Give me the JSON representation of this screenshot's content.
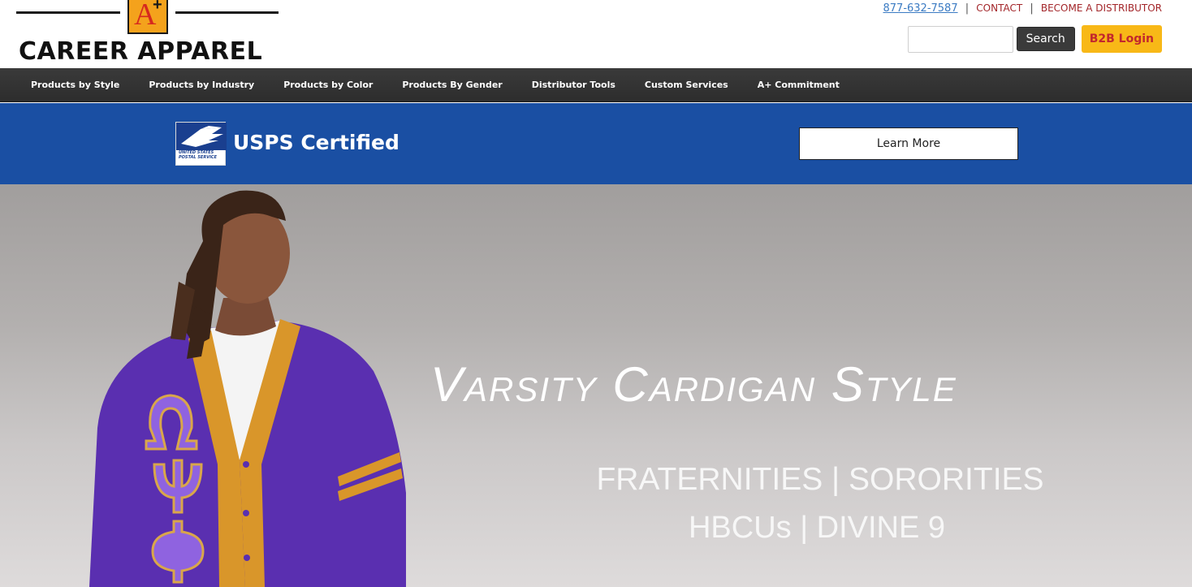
{
  "brand": {
    "logo_letter": "A",
    "logo_plus": "+",
    "name": "CAREER APPAREL"
  },
  "toplinks": {
    "phone": "877-632-7587",
    "separator": "|",
    "contact": "CONTACT",
    "distributor": "BECOME A DISTRIBUTOR"
  },
  "search": {
    "value": "",
    "placeholder": "",
    "button_label": "Search",
    "b2b_label": "B2B Login"
  },
  "nav": {
    "items": [
      {
        "label": "Products by Style"
      },
      {
        "label": "Products by Industry"
      },
      {
        "label": "Products by Color"
      },
      {
        "label": "Products By Gender"
      },
      {
        "label": "Distributor Tools"
      },
      {
        "label": "Custom Services"
      },
      {
        "label": "A+ Commitment"
      }
    ]
  },
  "usps_banner": {
    "logo_text": "UNITED STATES POSTAL SERVICE",
    "title": "USPS Certified",
    "button_label": "Learn More"
  },
  "hero": {
    "title": "Varsity Cardigan Style",
    "subtitle_line1": "FRATERNITIES | SORORITIES",
    "subtitle_line2": "HBCUs | DIVINE 9"
  },
  "colors": {
    "nav_bg": "#333333",
    "usps_blue": "#1a4fa3",
    "b2b_yellow": "#f8b817",
    "b2b_text": "#c2272d",
    "cardigan_purple": "#5a2fb0",
    "cardigan_gold": "#d9962a"
  }
}
